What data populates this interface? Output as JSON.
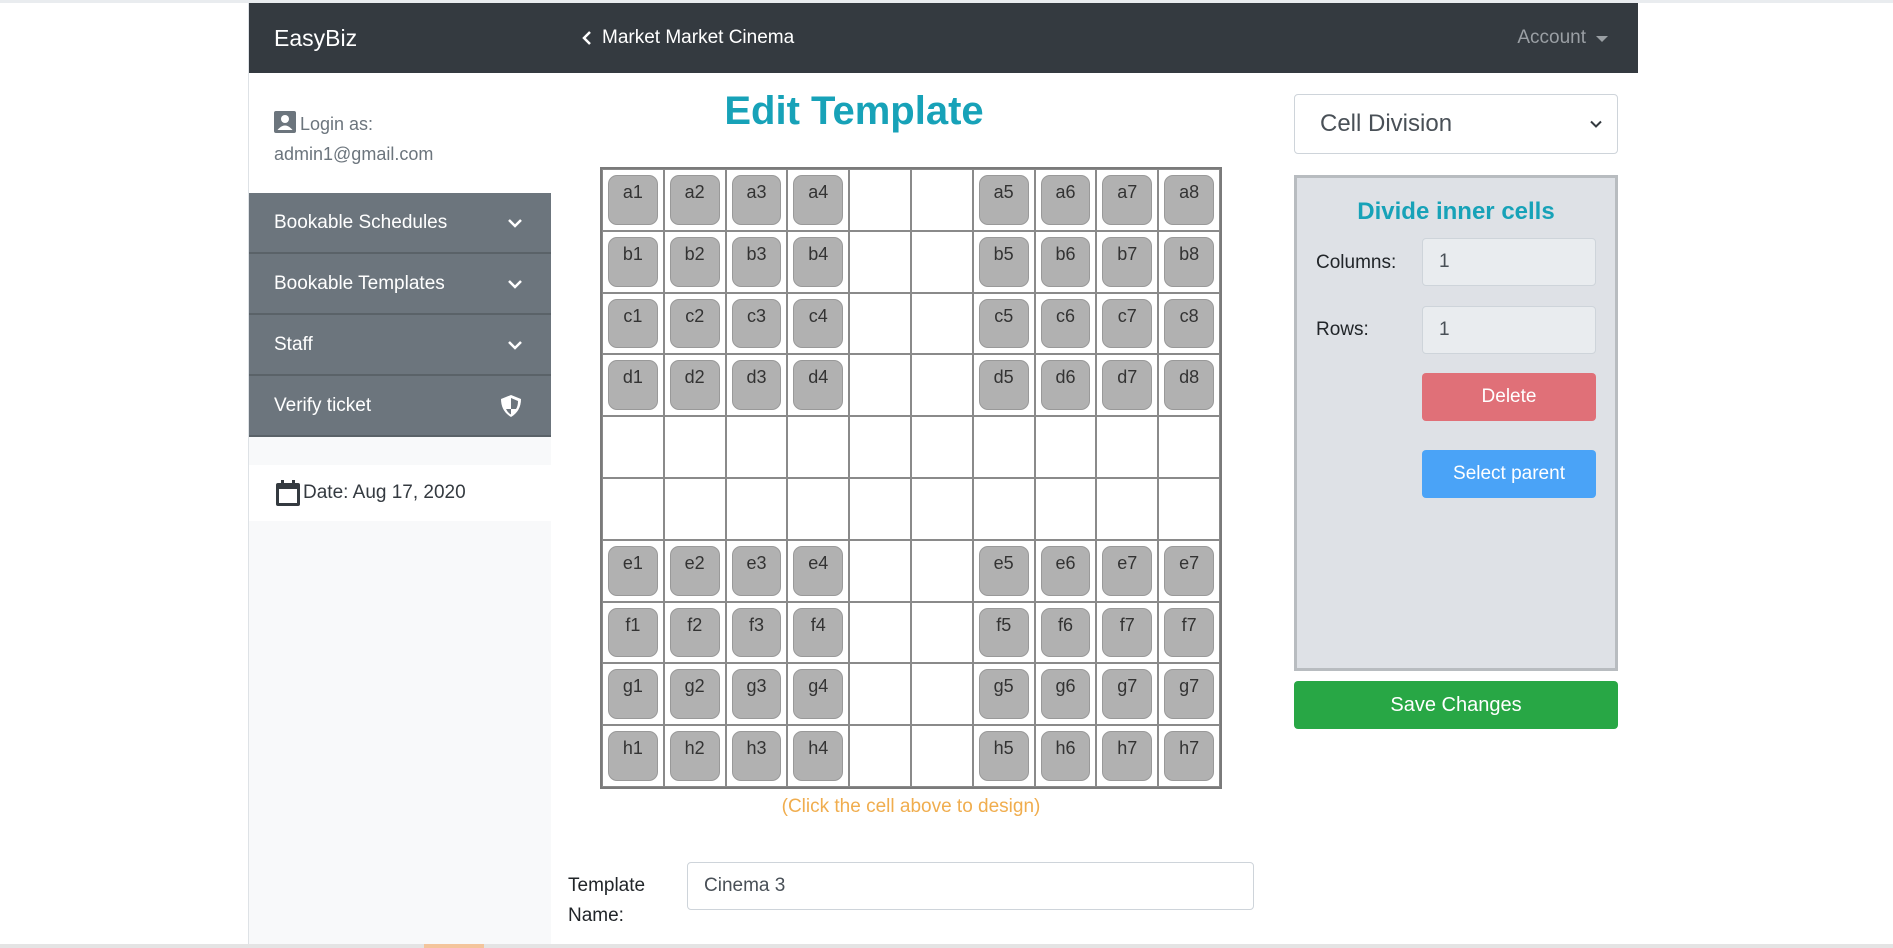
{
  "brand": "EasyBiz",
  "login": {
    "label": "Login as:",
    "email": "admin1@gmail.com"
  },
  "sidebar": {
    "items": [
      {
        "label": "Bookable Schedules",
        "icon": "chevron-down-icon"
      },
      {
        "label": "Bookable Templates",
        "icon": "chevron-down-icon"
      },
      {
        "label": "Staff",
        "icon": "chevron-down-icon"
      },
      {
        "label": "Verify ticket",
        "icon": "shield-icon"
      }
    ],
    "date": "Date: Aug 17, 2020"
  },
  "header": {
    "back_label": "Market Market Cinema",
    "account_label": "Account"
  },
  "main": {
    "title": "Edit Template",
    "hint": "(Click the cell above to design)",
    "template_name_label": "Template Name:",
    "template_name_value": "Cinema 3"
  },
  "grid": {
    "rows": [
      [
        "a1",
        "a2",
        "a3",
        "a4",
        "",
        "",
        "a5",
        "a6",
        "a7",
        "a8"
      ],
      [
        "b1",
        "b2",
        "b3",
        "b4",
        "",
        "",
        "b5",
        "b6",
        "b7",
        "b8"
      ],
      [
        "c1",
        "c2",
        "c3",
        "c4",
        "",
        "",
        "c5",
        "c6",
        "c7",
        "c8"
      ],
      [
        "d1",
        "d2",
        "d3",
        "d4",
        "",
        "",
        "d5",
        "d6",
        "d7",
        "d8"
      ],
      [
        "",
        "",
        "",
        "",
        "",
        "",
        "",
        "",
        "",
        ""
      ],
      [
        "",
        "",
        "",
        "",
        "",
        "",
        "",
        "",
        "",
        ""
      ],
      [
        "e1",
        "e2",
        "e3",
        "e4",
        "",
        "",
        "e5",
        "e6",
        "e7",
        "e7"
      ],
      [
        "f1",
        "f2",
        "f3",
        "f4",
        "",
        "",
        "f5",
        "f6",
        "f7",
        "f7"
      ],
      [
        "g1",
        "g2",
        "g3",
        "g4",
        "",
        "",
        "g5",
        "g6",
        "g7",
        "g7"
      ],
      [
        "h1",
        "h2",
        "h3",
        "h4",
        "",
        "",
        "h5",
        "h6",
        "h7",
        "h7"
      ]
    ]
  },
  "right_panel": {
    "select_value": "Cell Division",
    "panel_title": "Divide inner cells",
    "columns_label": "Columns:",
    "columns_value": "1",
    "rows_label": "Rows:",
    "rows_value": "1",
    "delete_label": "Delete",
    "select_parent_label": "Select parent",
    "save_label": "Save Changes"
  },
  "colors": {
    "accent": "#17a2b8",
    "sidebar_item": "#6c757d",
    "topbar": "#343a40",
    "save": "#28a745",
    "delete": "#e07078",
    "select_parent": "#4aa3f7",
    "hint": "#f0ad4e"
  }
}
